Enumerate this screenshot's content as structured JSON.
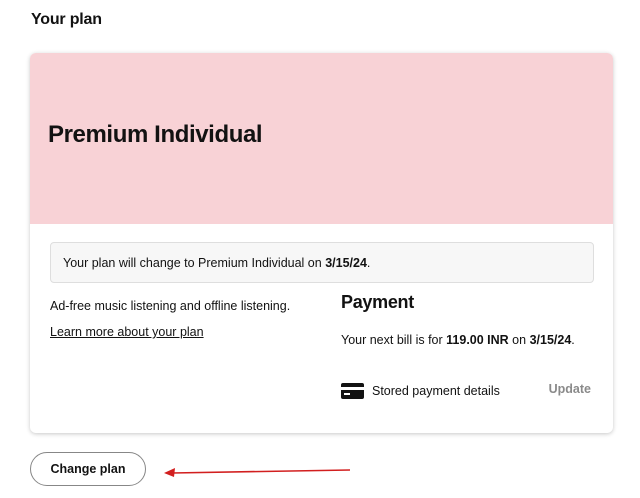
{
  "section_title": "Your plan",
  "plan": {
    "name": "Premium Individual",
    "notice_prefix": "Your plan will change to Premium Individual on ",
    "notice_date": "3/15/24",
    "notice_suffix": ".",
    "features": "Ad-free music listening and offline listening.",
    "learn_more": "Learn more about your plan",
    "header_color": "#f8d2d6"
  },
  "payment": {
    "title": "Payment",
    "bill_prefix": "Your next bill is for ",
    "bill_amount": "119.00 INR",
    "bill_mid": " on ",
    "bill_date": "3/15/24",
    "bill_suffix": ".",
    "stored_label": "Stored payment details",
    "update_label": "Update",
    "card_icon": "credit-card-icon"
  },
  "change_plan_label": "Change plan",
  "annotation": {
    "arrow_icon": "left-arrow-icon",
    "arrow_color": "#d21f1f"
  }
}
